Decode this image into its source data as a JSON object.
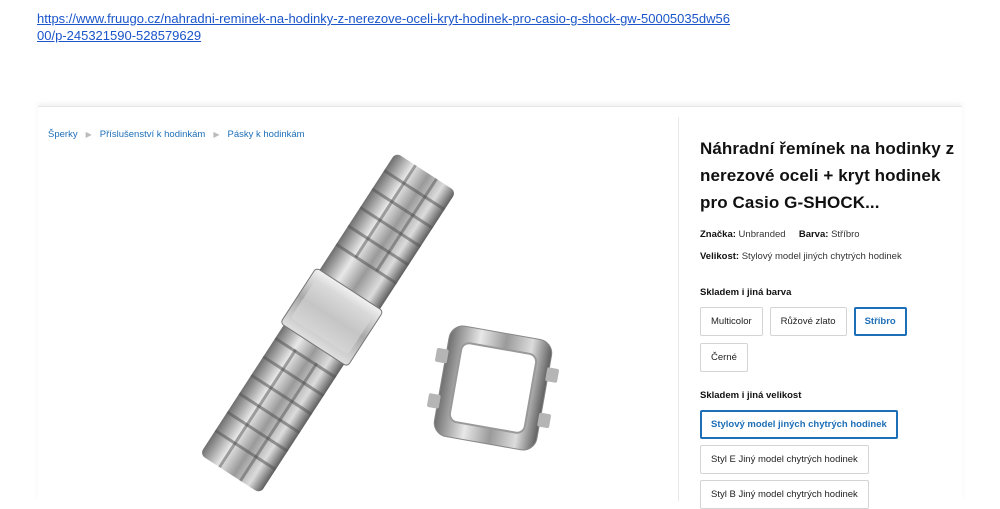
{
  "url": "https://www.fruugo.cz/nahradni-reminek-na-hodinky-z-nerezove-oceli-kryt-hodinek-pro-casio-g-shock-gw-50005035dw5600/p-245321590-528579629",
  "breadcrumb": [
    "Šperky",
    "Příslušenství k hodinkám",
    "Pásky k hodinkám"
  ],
  "product": {
    "title": "Náhradní řemínek na hodinky z nerezové oceli + kryt hodinek pro Casio G-SHOCK...",
    "brand_label": "Značka:",
    "brand": "Unbranded",
    "color_label": "Barva:",
    "color": "Stříbro",
    "size_label": "Velikost:",
    "size": "Stylový model jiných chytrých hodinek"
  },
  "color_options": {
    "label": "Skladem i jiná barva",
    "items": [
      "Multicolor",
      "Růžové zlato",
      "Stříbro",
      "Černé"
    ],
    "selected": "Stříbro"
  },
  "size_options": {
    "label": "Skladem i jiná velikost",
    "items": [
      "Stylový model jiných chytrých hodinek",
      "Styl E Jiný model chytrých hodinek",
      "Styl B Jiný model chytrých hodinek"
    ],
    "selected": "Stylový model jiných chytrých hodinek"
  },
  "colors": {
    "link": "#1a55c9",
    "accent": "#1d6fb8"
  }
}
